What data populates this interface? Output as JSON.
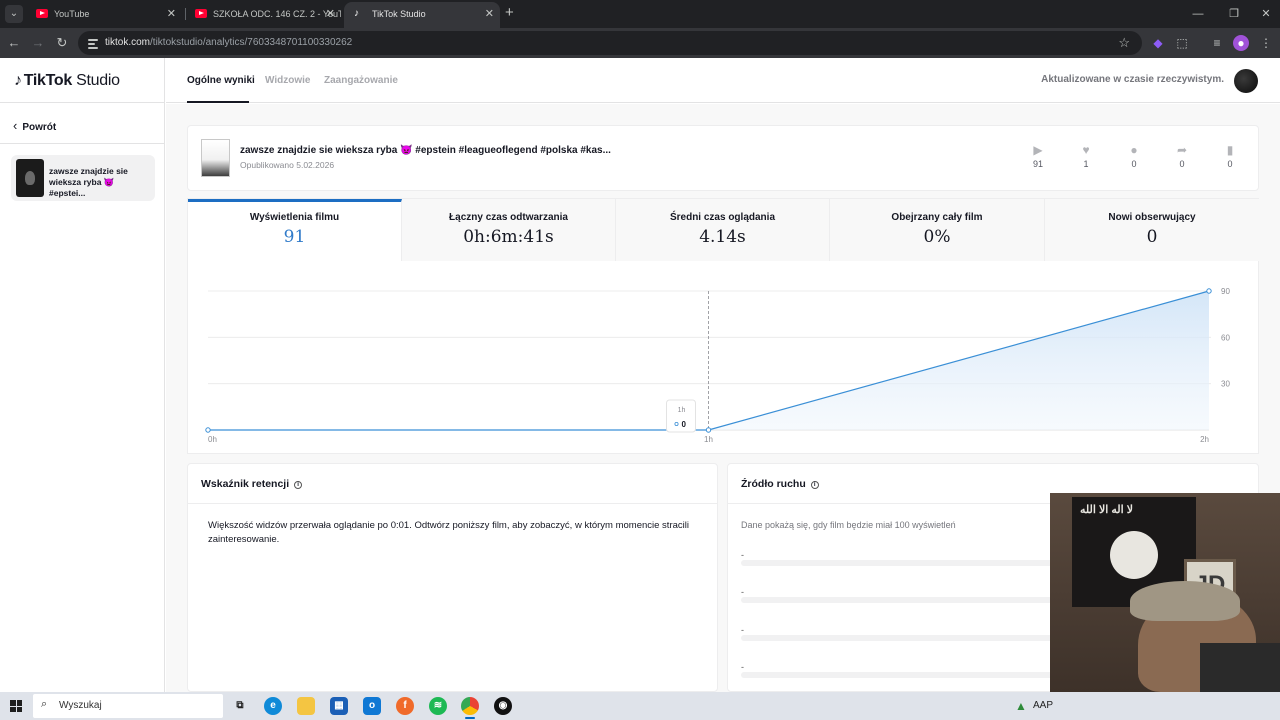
{
  "browser": {
    "tabs": [
      {
        "title": "YouTube",
        "active": false,
        "favicon": "youtube-icon"
      },
      {
        "title": "SZKOŁA ODC. 146 CZ. 2 - YouTu",
        "active": false,
        "favicon": "youtube-icon"
      },
      {
        "title": "TikTok Studio",
        "active": true,
        "favicon": "tiktok-icon"
      }
    ],
    "url_host": "tiktok.com",
    "url_path": "/tiktokstudio/analytics/7603348701100330262"
  },
  "sidebar": {
    "logo": "TikTok Studio",
    "logo_brand": "TikTok",
    "logo_suffix": "Studio",
    "back_label": "Powrót",
    "video_title": "zawsze znajdzie sie wieksza ryba 👿 #epstei..."
  },
  "topnav": {
    "tabs": [
      "Ogólne wyniki",
      "Widzowie",
      "Zaangażowanie"
    ],
    "active_tab": "Ogólne wyniki",
    "status": "Aktualizowane w czasie rzeczywistym."
  },
  "video": {
    "title": "zawsze znajdzie sie wieksza ryba 👿 #epstein #leagueoflegend #polska #kas...",
    "published": "Opublikowano 5.02.2026",
    "stats": [
      {
        "icon": "play-icon",
        "value": "91"
      },
      {
        "icon": "heart-icon",
        "value": "1"
      },
      {
        "icon": "comment-icon",
        "value": "0"
      },
      {
        "icon": "share-icon",
        "value": "0"
      },
      {
        "icon": "bookmark-icon",
        "value": "0"
      }
    ]
  },
  "metrics": [
    {
      "label": "Wyświetlenia filmu",
      "value": "91",
      "active": true
    },
    {
      "label": "Łączny czas odtwarzania",
      "value": "0h:6m:41s",
      "active": false
    },
    {
      "label": "Średni czas oglądania",
      "value": "4.14s",
      "active": false
    },
    {
      "label": "Obejrzany cały film",
      "value": "0%",
      "active": false
    },
    {
      "label": "Nowi obserwujący",
      "value": "0",
      "active": false
    }
  ],
  "chart_data": {
    "type": "area",
    "x": [
      "0h",
      "1h",
      "2h"
    ],
    "values": [
      0,
      0,
      90
    ],
    "ylim": [
      0,
      90
    ],
    "yticks": [
      "30",
      "60",
      "90"
    ],
    "xticks": [
      "0h",
      "1h",
      "2h"
    ],
    "tooltip": {
      "label": "1h",
      "value": "0"
    },
    "color": "#3a8fd6"
  },
  "retention": {
    "title": "Wskaźnik retencji",
    "text": "Większość widzów przerwała oglądanie po 0:01. Odtwórz poniższy film, aby zobaczyć, w którym momencie stracili zainteresowanie."
  },
  "traffic": {
    "title": "Źródło ruchu",
    "text": "Dane pokażą się, gdy film będzie miał 100 wyświetleń",
    "rows": [
      "-",
      "-",
      "-",
      "-"
    ]
  },
  "webcam": {
    "flag_text": "لا اله الا الله",
    "frame_text": "JD"
  },
  "taskbar": {
    "search_placeholder": "Wyszukaj",
    "tray_text": "AAP"
  }
}
